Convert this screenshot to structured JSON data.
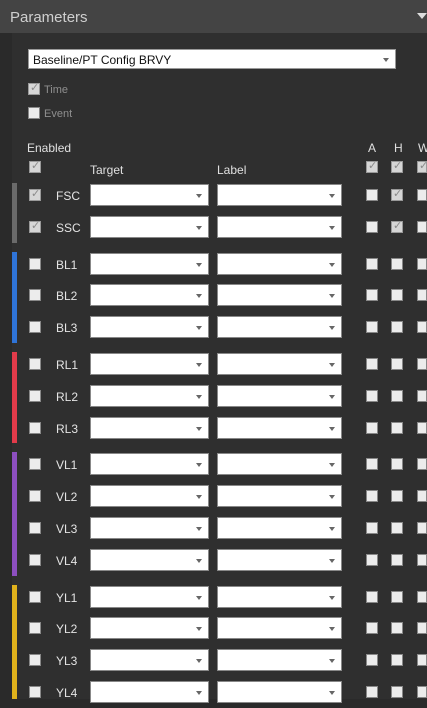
{
  "panel": {
    "title": "Parameters"
  },
  "config": {
    "selected": "Baseline/PT Config BRVY"
  },
  "options": [
    {
      "label": "Time",
      "checked": true
    },
    {
      "label": "Event",
      "checked": false
    }
  ],
  "headers": {
    "enabled": "Enabled",
    "target": "Target",
    "label": "Label",
    "a": "A",
    "h": "H",
    "w": "W"
  },
  "groups": [
    {
      "color": "#6a6a6a",
      "rows": [
        {
          "name": "FSC",
          "enabled": true,
          "a": false,
          "h": true,
          "w": false
        },
        {
          "name": "SSC",
          "enabled": true,
          "a": false,
          "h": true,
          "w": false
        }
      ]
    },
    {
      "color": "#2f74d8",
      "rows": [
        {
          "name": "BL1",
          "enabled": false,
          "a": false,
          "h": false,
          "w": false
        },
        {
          "name": "BL2",
          "enabled": false,
          "a": false,
          "h": false,
          "w": false
        },
        {
          "name": "BL3",
          "enabled": false,
          "a": false,
          "h": false,
          "w": false
        }
      ]
    },
    {
      "color": "#e23b4a",
      "rows": [
        {
          "name": "RL1",
          "enabled": false,
          "a": false,
          "h": false,
          "w": false
        },
        {
          "name": "RL2",
          "enabled": false,
          "a": false,
          "h": false,
          "w": false
        },
        {
          "name": "RL3",
          "enabled": false,
          "a": false,
          "h": false,
          "w": false
        }
      ]
    },
    {
      "color": "#8d4fc0",
      "rows": [
        {
          "name": "VL1",
          "enabled": false,
          "a": false,
          "h": false,
          "w": false
        },
        {
          "name": "VL2",
          "enabled": false,
          "a": false,
          "h": false,
          "w": false
        },
        {
          "name": "VL3",
          "enabled": false,
          "a": false,
          "h": false,
          "w": false
        },
        {
          "name": "VL4",
          "enabled": false,
          "a": false,
          "h": false,
          "w": false
        }
      ]
    },
    {
      "color": "#e0b21c",
      "rows": [
        {
          "name": "YL1",
          "enabled": false,
          "a": false,
          "h": false,
          "w": false
        },
        {
          "name": "YL2",
          "enabled": false,
          "a": false,
          "h": false,
          "w": false
        },
        {
          "name": "YL3",
          "enabled": false,
          "a": false,
          "h": false,
          "w": false
        },
        {
          "name": "YL4",
          "enabled": false,
          "a": false,
          "h": false,
          "w": false
        }
      ]
    }
  ]
}
